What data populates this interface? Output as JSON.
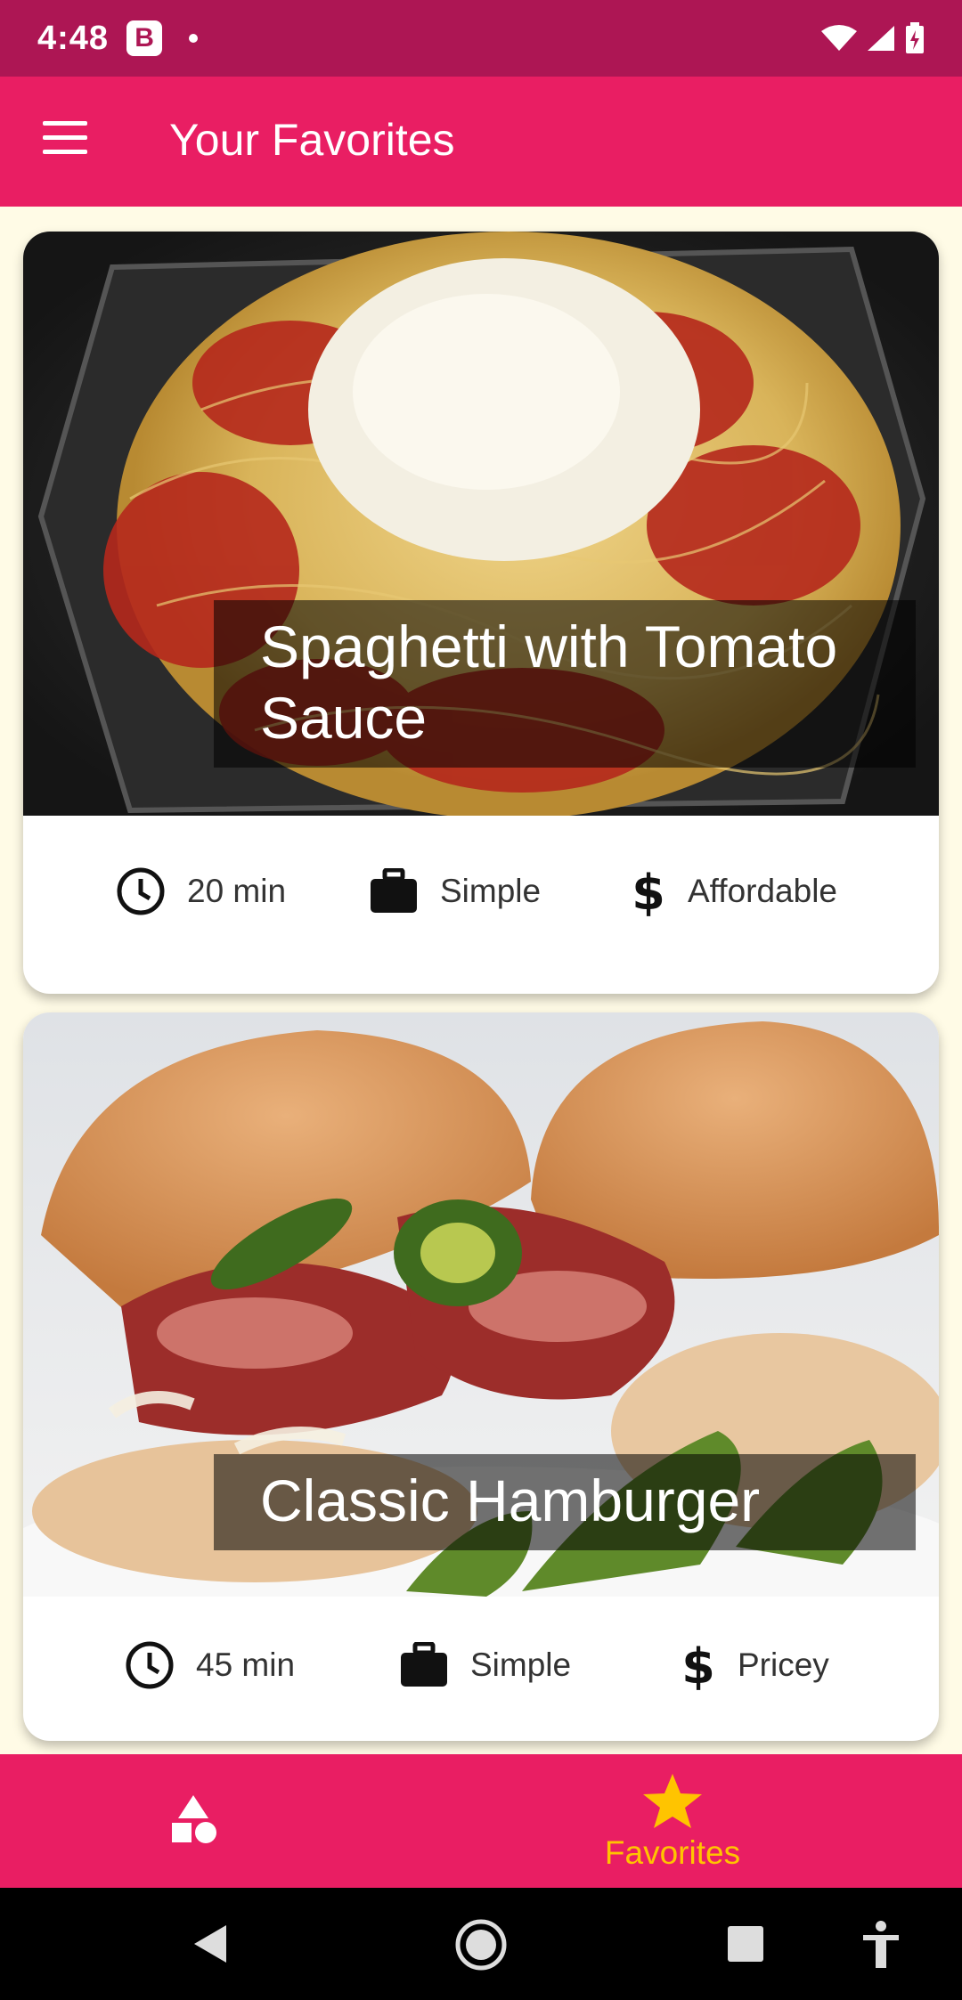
{
  "status_bar": {
    "time": "4:48",
    "badge": "B"
  },
  "app_bar": {
    "title": "Your Favorites",
    "menu_icon": "hamburger-menu-icon"
  },
  "meals": [
    {
      "title": "Spaghetti with Tomato Sauce",
      "duration": "20 min",
      "complexity": "Simple",
      "affordability": "Affordable"
    },
    {
      "title": "Classic Hamburger",
      "duration": "45 min",
      "complexity": "Simple",
      "affordability": "Pricey"
    }
  ],
  "bottom_nav": {
    "items": [
      {
        "icon": "categories-shapes-icon",
        "label": ""
      },
      {
        "icon": "star-icon",
        "label": "Favorites"
      }
    ],
    "active_color": "#ffc400"
  },
  "colors": {
    "primary": "#e91e63",
    "status_bar": "#ad1654",
    "background": "#fffbe6",
    "accent": "#ffc400"
  }
}
